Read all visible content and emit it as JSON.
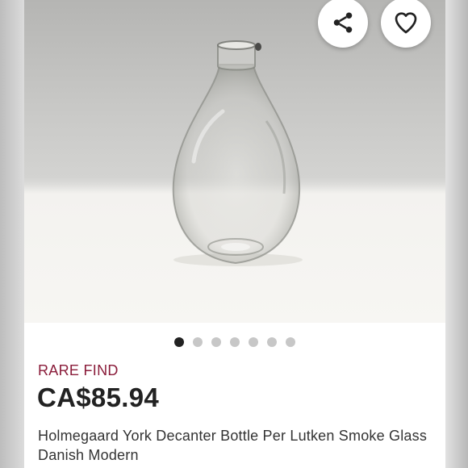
{
  "listing": {
    "badge": "RARE FIND",
    "price": "CA$85.94",
    "title": "Holmegaard York Decanter Bottle Per Lutken Smoke Glass Danish Modern"
  },
  "gallery": {
    "image_subject": "glass-decanter-bottle",
    "image_count": 7,
    "active_index": 0
  },
  "actions": {
    "share_icon": "share-icon",
    "like_icon": "heart-icon"
  },
  "colors": {
    "badge": "#8a1c3a",
    "price": "#222222",
    "dot_active": "#222222",
    "dot_inactive": "#c7c7c7"
  }
}
